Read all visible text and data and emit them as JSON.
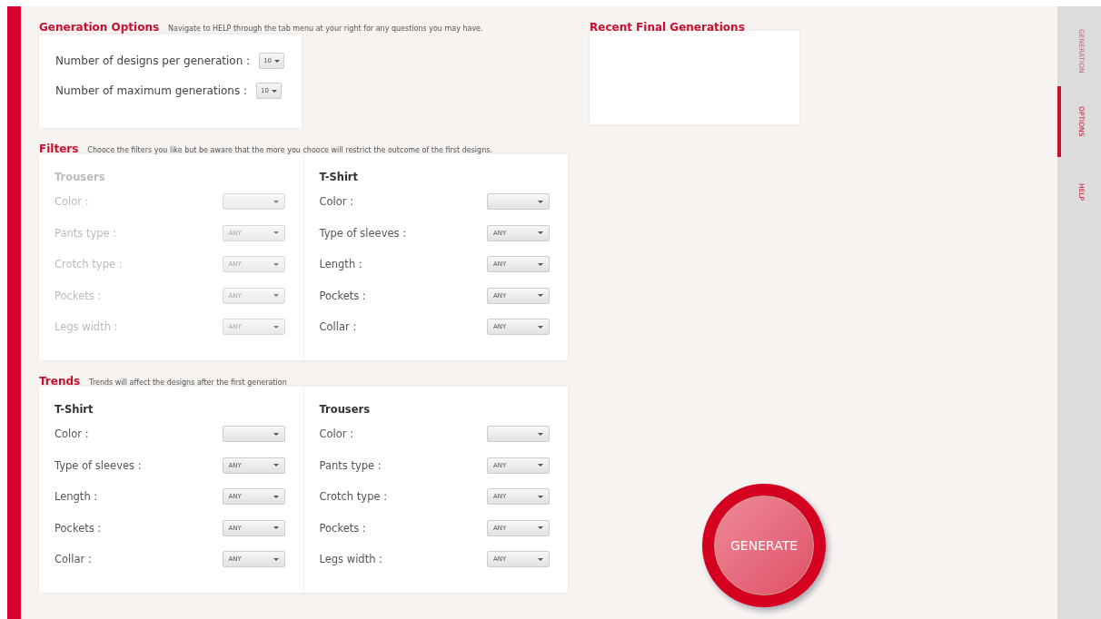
{
  "generation_options": {
    "title": "Generation Options",
    "hint": "Navigate to HELP through the tab menu at your right for any questions you may have.",
    "fields": [
      {
        "label": "Number of designs per generation :",
        "value": "10"
      },
      {
        "label": "Number of maximum generations :",
        "value": "10"
      }
    ]
  },
  "recent": {
    "title": "Recent Final Generations"
  },
  "filters": {
    "title": "Filters",
    "hint": "Chooce the filters you like but be aware that the more you chooce will restrict the outcome of the first designs.",
    "groups": [
      {
        "title": "Trousers",
        "disabled": true,
        "fields": [
          {
            "label": "Color :"
          },
          {
            "label": "Pants type :",
            "value": "ANY"
          },
          {
            "label": "Crotch type :",
            "value": "ANY"
          },
          {
            "label": "Pockets :",
            "value": "ANY"
          },
          {
            "label": "Legs width :",
            "value": "ANY"
          }
        ]
      },
      {
        "title": "T-Shirt",
        "disabled": false,
        "fields": [
          {
            "label": "Color :"
          },
          {
            "label": "Type of sleeves :",
            "value": "ANY"
          },
          {
            "label": "Length :",
            "value": "ANY"
          },
          {
            "label": "Pockets :",
            "value": "ANY"
          },
          {
            "label": "Collar :",
            "value": "ANY"
          }
        ]
      }
    ]
  },
  "trends": {
    "title": "Trends",
    "hint": "Trends will affect the designs after the first generation",
    "groups": [
      {
        "title": "T-Shirt",
        "disabled": false,
        "fields": [
          {
            "label": "Color :"
          },
          {
            "label": "Type of sleeves :",
            "value": "ANY"
          },
          {
            "label": "Length :",
            "value": "ANY"
          },
          {
            "label": "Pockets :",
            "value": "ANY"
          },
          {
            "label": "Collar :",
            "value": "ANY"
          }
        ]
      },
      {
        "title": "Trousers",
        "disabled": false,
        "fields": [
          {
            "label": "Color :"
          },
          {
            "label": "Pants type :",
            "value": "ANY"
          },
          {
            "label": "Crotch type :",
            "value": "ANY"
          },
          {
            "label": "Pockets :",
            "value": "ANY"
          },
          {
            "label": "Legs width :",
            "value": "ANY"
          }
        ]
      }
    ]
  },
  "generate_button": {
    "label": "GENERATE"
  },
  "tabs": [
    {
      "label": "GENERATION",
      "selected": false,
      "disabled": true
    },
    {
      "label": "OPTIONS",
      "selected": true,
      "disabled": false
    },
    {
      "label": "HELP",
      "selected": false,
      "disabled": false
    }
  ]
}
